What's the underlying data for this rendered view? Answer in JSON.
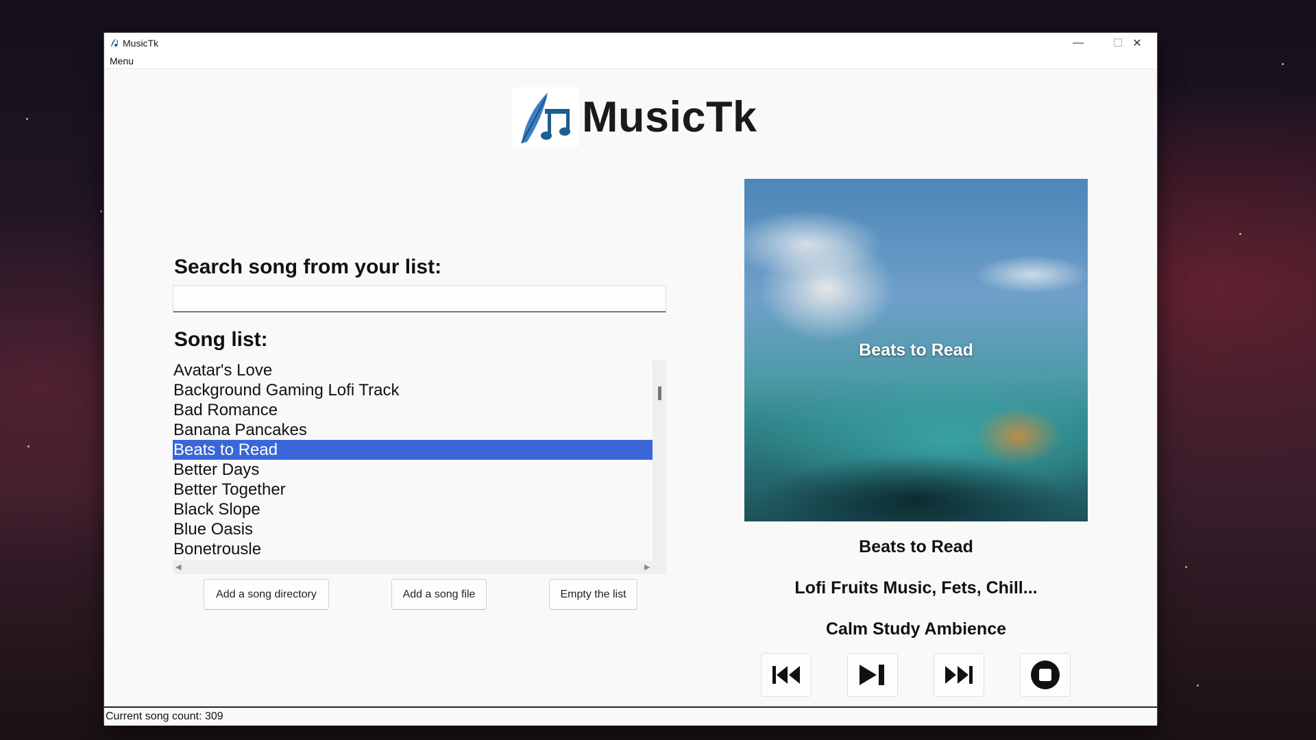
{
  "window": {
    "title": "MusicTk",
    "minimize_glyph": "—",
    "maximize_glyph": "☐",
    "close_glyph": "✕"
  },
  "menubar": {
    "menu_label": "Menu"
  },
  "logo": {
    "text": "MusicTk",
    "icon": "feather-music-note-icon"
  },
  "search": {
    "label": "Search song from your list:",
    "value": "",
    "placeholder": ""
  },
  "song_list": {
    "label": "Song list:",
    "items": [
      "Avatar's Love",
      "Background Gaming Lofi Track",
      "Bad Romance",
      "Banana Pancakes",
      "Beats to Read",
      "Better Days",
      "Better Together",
      "Black Slope",
      "Blue Oasis",
      "Bonetrousle"
    ],
    "selected_index": 4
  },
  "buttons": {
    "add_directory": "Add a song directory",
    "add_file": "Add a song file",
    "empty_list": "Empty the list"
  },
  "now_playing": {
    "art_caption": "Beats to Read",
    "title": "Beats to Read",
    "artist": "Lofi Fruits Music, Fets, Chill...",
    "album": "Calm Study Ambience"
  },
  "controls": {
    "previous": "previous-track-icon",
    "play_pause": "play-pause-icon",
    "next": "next-track-icon",
    "stop": "stop-icon"
  },
  "status": {
    "text": "Current song count: 309"
  },
  "colors": {
    "selection": "#3a66d8",
    "window_bg": "#f9f9f9",
    "text": "#111111"
  }
}
